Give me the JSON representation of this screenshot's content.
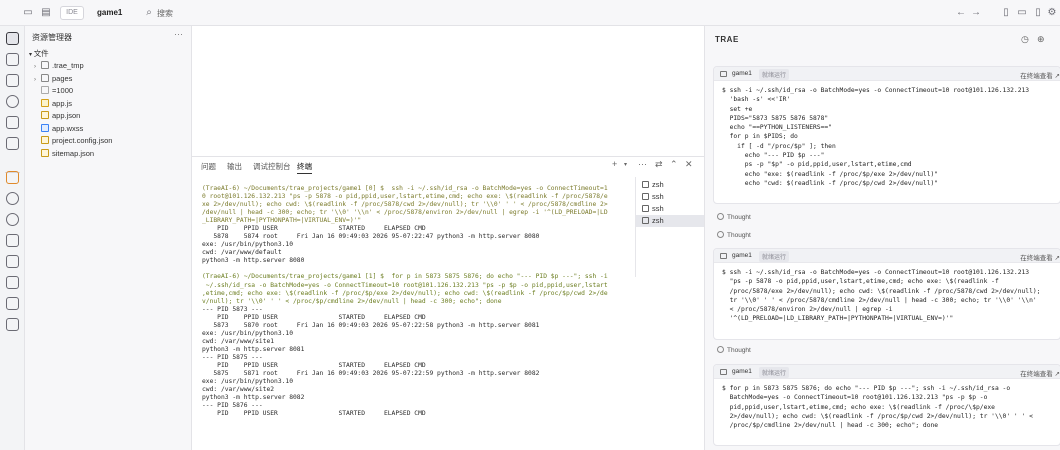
{
  "topbar": {
    "ide_label": "IDE",
    "project": "game1",
    "search": "搜索"
  },
  "explorer": {
    "title": "资源管理器",
    "more": "···",
    "root": "文件",
    "items": [
      {
        "name": ".trae_tmp",
        "type": "folder"
      },
      {
        "name": "pages",
        "type": "folder"
      },
      {
        "name": "=1000",
        "type": "plain"
      },
      {
        "name": "app.js",
        "type": "js"
      },
      {
        "name": "app.json",
        "type": "json"
      },
      {
        "name": "app.wxss",
        "type": "wxss"
      },
      {
        "name": "project.config.json",
        "type": "json"
      },
      {
        "name": "sitemap.json",
        "type": "json"
      }
    ]
  },
  "panel": {
    "tabs": [
      "问题",
      "输出",
      "调试控制台",
      "终端"
    ],
    "active_tab": "终端",
    "sessions": [
      "zsh",
      "ssh",
      "ssh",
      "zsh"
    ],
    "terminal": [
      {
        "t": "(TraeAI-6) ~/Documents/trae_projects/game1 [0] $  ssh -i ~/.ssh/id_rsa -o BatchMode=yes -o ConnectTimeout=1",
        "c": "cmd"
      },
      {
        "t": "0 root@101.126.132.213 \"ps -p 5878 -o pid,ppid,user,lstart,etime,cmd; echo exe: \\$(readlink -f /proc/5878/e",
        "c": "cmd"
      },
      {
        "t": "xe 2>/dev/null); echo cwd: \\$(readlink -f /proc/5878/cwd 2>/dev/null); tr '\\\\0' ' ' < /proc/5878/cmdline 2>",
        "c": "cmd"
      },
      {
        "t": "/dev/null | head -c 300; echo; tr '\\\\0' '\\\\n' < /proc/5878/environ 2>/dev/null | egrep -i '^(LD_PRELOAD=|LD",
        "c": "cmd"
      },
      {
        "t": "_LIBRARY_PATH=|PYTHONPATH=|VIRTUAL_ENV=)'\"",
        "c": "cmd"
      },
      {
        "t": "    PID    PPID USER                STARTED     ELAPSED CMD",
        "c": ""
      },
      {
        "t": "   5878    5874 root     Fri Jan 16 09:49:03 2026 95-07:22:47 python3 -m http.server 8080",
        "c": ""
      },
      {
        "t": "exe: /usr/bin/python3.10",
        "c": ""
      },
      {
        "t": "cwd: /var/www/default",
        "c": ""
      },
      {
        "t": "python3 -m http.server 8080",
        "c": ""
      },
      {
        "t": "",
        "c": "gap"
      },
      {
        "t": "(TraeAI-6) ~/Documents/trae_projects/game1 [1] $  for p in 5873 5875 5876; do echo \"--- PID $p ---\"; ssh -i",
        "c": "cmd2"
      },
      {
        "t": " ~/.ssh/id_rsa -o BatchMode=yes -o ConnectTimeout=10 root@101.126.132.213 \"ps -p $p -o pid,ppid,user,lstart",
        "c": "cmd2"
      },
      {
        "t": ",etime,cmd; echo exe: \\$(readlink -f /proc/$p/exe 2>/dev/null); echo cwd: \\$(readlink -f /proc/$p/cwd 2>/de",
        "c": "cmd2"
      },
      {
        "t": "v/null); tr '\\\\0' ' ' < /proc/$p/cmdline 2>/dev/null | head -c 300; echo\"; done",
        "c": "cmd2"
      },
      {
        "t": "--- PID 5873 ---",
        "c": ""
      },
      {
        "t": "    PID    PPID USER                STARTED     ELAPSED CMD",
        "c": ""
      },
      {
        "t": "   5873    5870 root     Fri Jan 16 09:49:03 2026 95-07:22:58 python3 -m http.server 8081",
        "c": ""
      },
      {
        "t": "exe: /usr/bin/python3.10",
        "c": ""
      },
      {
        "t": "cwd: /var/www/site1",
        "c": ""
      },
      {
        "t": "python3 -m http.server 8081",
        "c": ""
      },
      {
        "t": "--- PID 5875 ---",
        "c": ""
      },
      {
        "t": "    PID    PPID USER                STARTED     ELAPSED CMD",
        "c": ""
      },
      {
        "t": "   5875    5871 root     Fri Jan 16 09:49:03 2026 95-07:22:59 python3 -m http.server 8082",
        "c": ""
      },
      {
        "t": "exe: /usr/bin/python3.10",
        "c": ""
      },
      {
        "t": "cwd: /var/www/site2",
        "c": ""
      },
      {
        "t": "python3 -m http.server 8082",
        "c": ""
      },
      {
        "t": "--- PID 5876 ---",
        "c": ""
      },
      {
        "t": "    PID    PPID USER                STARTED     ELAPSED CMD",
        "c": ""
      }
    ]
  },
  "chat": {
    "title": "TRAE",
    "cards": [
      {
        "title": "game1",
        "status": "就绪运行",
        "action": "在终端查看 ↗",
        "lines": [
          "$ ssh -i ~/.ssh/id_rsa -o BatchMode=yes -o ConnectTimeout=10 root@101.126.132.213",
          "  'bash -s' <<'IR'",
          "  set +e",
          "  PIDS=\"5873 5875 5876 5878\"",
          "  echo \"==PYTHON_LISTENERS==\"",
          "  for p in $PIDS; do",
          "    if [ -d \"/proc/$p\" ]; then",
          "      echo \"--- PID $p ---\"",
          "      ps -p \"$p\" -o pid,ppid,user,lstart,etime,cmd",
          "      echo \"exe: $(readlink -f /proc/$p/exe 2>/dev/null)\"",
          "      echo \"cwd: $(readlink -f /proc/$p/cwd 2>/dev/null)\""
        ]
      },
      {
        "title": "game1",
        "status": "就绪运行",
        "action": "在终端查看 ↗",
        "lines": [
          "$ ssh -i ~/.ssh/id_rsa -o BatchMode=yes -o ConnectTimeout=10 root@101.126.132.213",
          "  \"ps -p 5878 -o pid,ppid,user,lstart,etime,cmd; echo exe: \\$(readlink -f",
          "  /proc/5878/exe 2>/dev/null); echo cwd: \\$(readlink -f /proc/5878/cwd 2>/dev/null);",
          "  tr '\\\\0' ' ' < /proc/5878/cmdline 2>/dev/null | head -c 300; echo; tr '\\\\0' '\\\\n'",
          "  < /proc/5878/environ 2>/dev/null | egrep -i",
          "  '^(LD_PRELOAD=|LD_LIBRARY_PATH=|PYTHONPATH=|VIRTUAL_ENV=)'\""
        ]
      },
      {
        "title": "game1",
        "status": "就绪运行",
        "action": "在终端查看 ↗",
        "lines": [
          "$ for p in 5873 5875 5876; do echo \"--- PID $p ---\"; ssh -i ~/.ssh/id_rsa -o",
          "  BatchMode=yes -o ConnectTimeout=10 root@101.126.132.213 \"ps -p $p -o",
          "  pid,ppid,user,lstart,etime,cmd; echo exe: \\$(readlink -f /proc/\\$p/exe",
          "  2>/dev/null); echo cwd: \\$(readlink -f /proc/$p/cwd 2>/dev/null); tr '\\\\0' ' ' <",
          "  /proc/$p/cmdline 2>/dev/null | head -c 300; echo\"; done"
        ]
      }
    ],
    "thought_label": "Thought"
  }
}
